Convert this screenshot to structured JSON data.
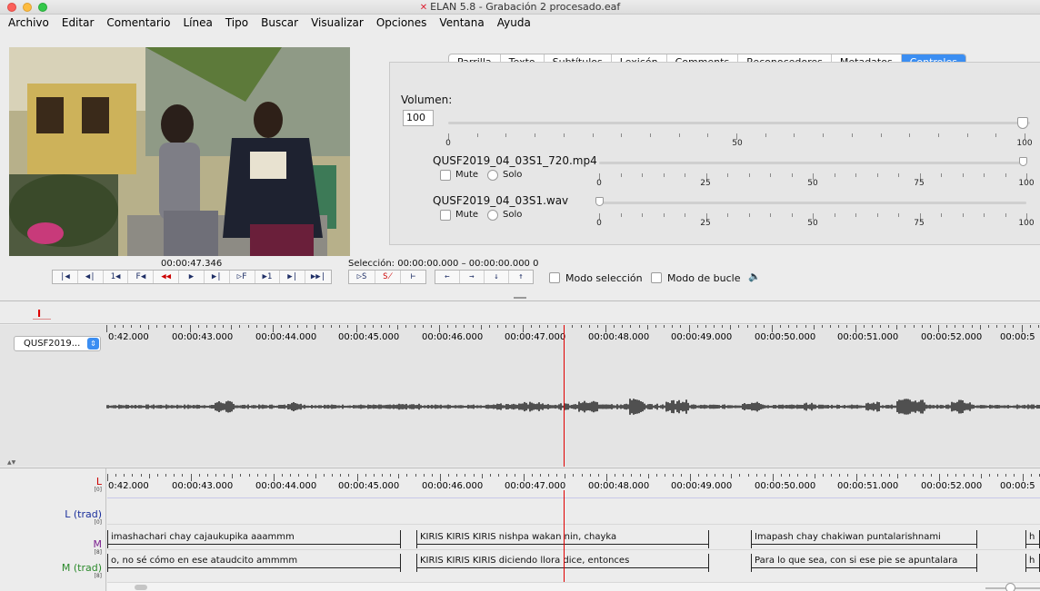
{
  "window": {
    "title": "ELAN 5.8 - Grabación 2 procesado.eaf"
  },
  "menu": [
    "Archivo",
    "Editar",
    "Comentario",
    "Línea",
    "Tipo",
    "Buscar",
    "Visualizar",
    "Opciones",
    "Ventana",
    "Ayuda"
  ],
  "tabs": [
    {
      "label": "Parrilla",
      "active": false
    },
    {
      "label": "Texto",
      "active": false
    },
    {
      "label": "Subtítulos",
      "active": false
    },
    {
      "label": "Lexicón",
      "active": false
    },
    {
      "label": "Comments",
      "active": false
    },
    {
      "label": "Reconocedores",
      "active": false
    },
    {
      "label": "Metadatos",
      "active": false
    },
    {
      "label": "Controles",
      "active": true
    }
  ],
  "controls": {
    "volume_label": "Volumen:",
    "volume_value": "100",
    "volume_ticks": [
      "0",
      "50",
      "100"
    ],
    "media": [
      {
        "file": "QUSF2019_04_03S1_720.mp4",
        "mute": "Mute",
        "solo": "Solo",
        "level": 100
      },
      {
        "file": "QUSF2019_04_03S1.wav",
        "mute": "Mute",
        "solo": "Solo",
        "level": 0
      }
    ],
    "media_ticks": [
      "0",
      "25",
      "50",
      "75",
      "100"
    ]
  },
  "playback": {
    "timecode": "00:00:47.346",
    "selection": "Selección: 00:00:00.000 – 00:00:00.000  0",
    "mode_selection": "Modo selección",
    "loop_mode": "Modo de bucle",
    "buttons": [
      "|◀",
      "◀|",
      "1◀",
      "F◀",
      "◀◀",
      "▶",
      "▶|",
      "▷F",
      "▶1",
      "▶|",
      "▶▶|"
    ],
    "sel_buttons": [
      "▷S",
      "S̸",
      "⊢"
    ],
    "nav_buttons": [
      "←",
      "→",
      "↓",
      "↑"
    ]
  },
  "waveform": {
    "media_select": "QUSF2019...",
    "ruler": [
      "0:42.000",
      "00:00:43.000",
      "00:00:44.000",
      "00:00:45.000",
      "00:00:46.000",
      "00:00:47.000",
      "00:00:48.000",
      "00:00:49.000",
      "00:00:50.000",
      "00:00:51.000",
      "00:00:52.000",
      "00:00:5"
    ]
  },
  "tiers": {
    "names": [
      {
        "name": "L",
        "count": "[0]",
        "color": "#cc0000"
      },
      {
        "name": "L (trad)",
        "count": "[0]",
        "color": "#1a2f9c"
      },
      {
        "name": "M",
        "count": "[8]",
        "color": "#7a1f8f"
      },
      {
        "name": "M (trad)",
        "count": "[8]",
        "color": "#2b8a2b"
      }
    ],
    "ruler": [
      "0:42.000",
      "00:00:43.000",
      "00:00:44.000",
      "00:00:45.000",
      "00:00:46.000",
      "00:00:47.000",
      "00:00:48.000",
      "00:00:49.000",
      "00:00:50.000",
      "00:00:51.000",
      "00:00:52.000",
      "00:00:5"
    ],
    "m_annotations": [
      "imashachari chay cajaukupika aaammm",
      "KIRIS KIRIS KIRIS nishpa wakan nin, chayka",
      "Imapash chay chakiwan puntalarishnami",
      "h"
    ],
    "mtrad_annotations": [
      "o, no sé cómo en ese ataudcito ammmm",
      "KIRIS KIRIS KIRIS diciendo llora dice, entonces",
      "Para lo que sea, con si ese pie se apuntalara",
      "h"
    ]
  }
}
